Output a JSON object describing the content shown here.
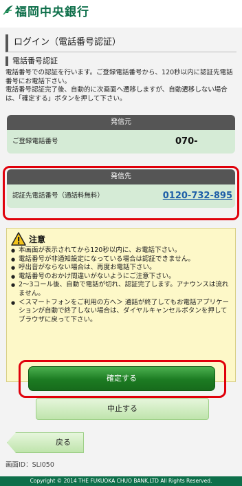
{
  "header": {
    "bank_name": "福岡中央銀行",
    "logo_icon": "bank-logo-icon"
  },
  "page": {
    "title": "ログイン（電話番号認証）"
  },
  "section": {
    "title": "電話番号認証",
    "description": [
      "電話番号での認証を行います。ご登録電話番号から、120秒以内に認証先電話番号にお電話下さい。",
      "電話番号認証完了後、自動的に次画面へ遷移しますが、自動遷移しない場合は、「確定する」ボタンを押して下さい。"
    ]
  },
  "from": {
    "heading": "発信元",
    "label": "ご登録電話番号",
    "value": "070-"
  },
  "to": {
    "heading": "発信先",
    "label": "認証先電話番号（通話料無料）",
    "value": "0120-732-895"
  },
  "notice": {
    "title": "注意",
    "icon": "warning-icon",
    "items": [
      "本画面が表示されてから120秒以内に、お電話下さい。",
      "電話番号が非通知設定になっている場合は認証できません。",
      "呼出音がならない場合は、再度お電話下さい。",
      "電話番号のおかけ間違いがないようにご注意下さい。",
      "2～3コール後、自動で電話が切れ、認証完了します。アナウンスは流れません。",
      "＜スマートフォンをご利用の方へ＞ 通話が終了してもお電話アプリケーションが自動で終了しない場合は、ダイヤルキャンセルボタンを押してブラウザに戻って下さい。"
    ]
  },
  "buttons": {
    "confirm": "確定する",
    "cancel": "中止する",
    "back": "戻る"
  },
  "screen_id": "画面ID：SLI050",
  "footer": {
    "copyright": "Copyright © 2014 THE FUKUOKA CHUO BANK,LTD All Rights Reserved."
  },
  "colors": {
    "brand": "#0e6f4a",
    "accent_red": "#e0000b",
    "link": "#1e5fa8"
  }
}
